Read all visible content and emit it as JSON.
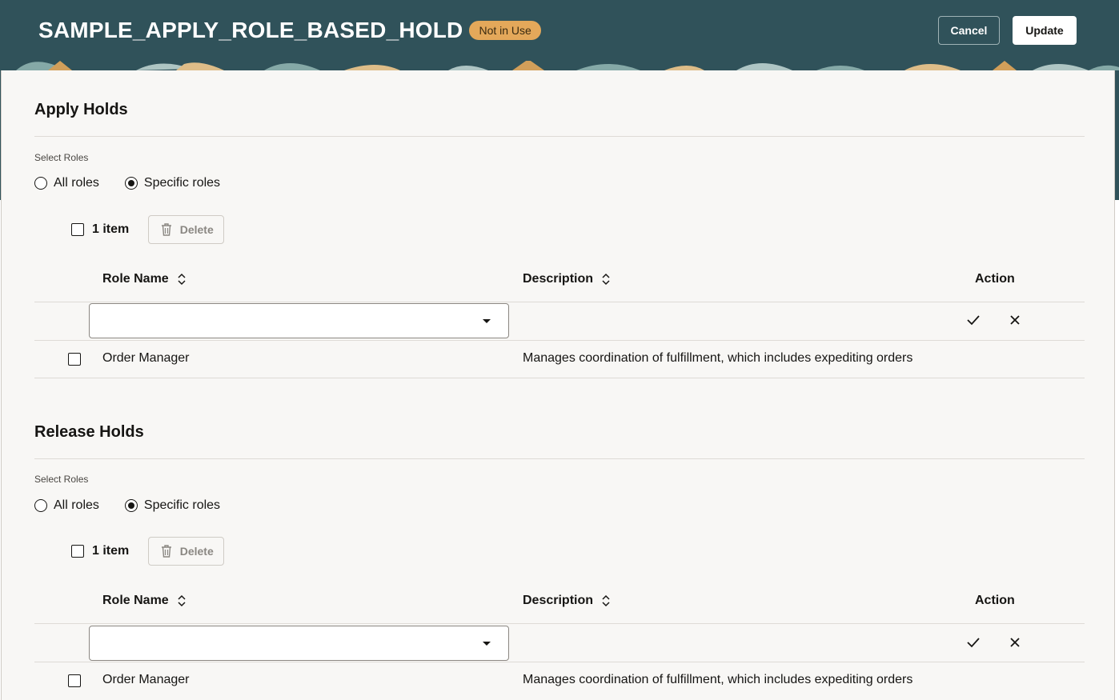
{
  "header": {
    "title": "SAMPLE_APPLY_ROLE_BASED_HOLD",
    "status": "Not in Use",
    "cancel_label": "Cancel",
    "update_label": "Update"
  },
  "apply": {
    "title": "Apply Holds",
    "select_label": "Select Roles",
    "radio_all": "All roles",
    "radio_specific": "Specific roles",
    "selected": "specific",
    "item_count": "1 item",
    "delete_label": "Delete",
    "columns": {
      "role": "Role Name",
      "description": "Description",
      "action": "Action"
    },
    "rows": [
      {
        "role": "Order Manager",
        "description": "Manages coordination of fulfillment, which includes expediting orders"
      }
    ]
  },
  "release": {
    "title": "Release Holds",
    "select_label": "Select Roles",
    "radio_all": "All roles",
    "radio_specific": "Specific roles",
    "selected": "specific",
    "item_count": "1 item",
    "delete_label": "Delete",
    "columns": {
      "role": "Role Name",
      "description": "Description",
      "action": "Action"
    },
    "rows": [
      {
        "role": "Order Manager",
        "description": "Manages coordination of fulfillment, which includes expediting orders"
      }
    ]
  },
  "colors": {
    "header_bg": "#30525a",
    "badge_bg": "#e4a85a",
    "content_bg": "#f8f7f5"
  }
}
